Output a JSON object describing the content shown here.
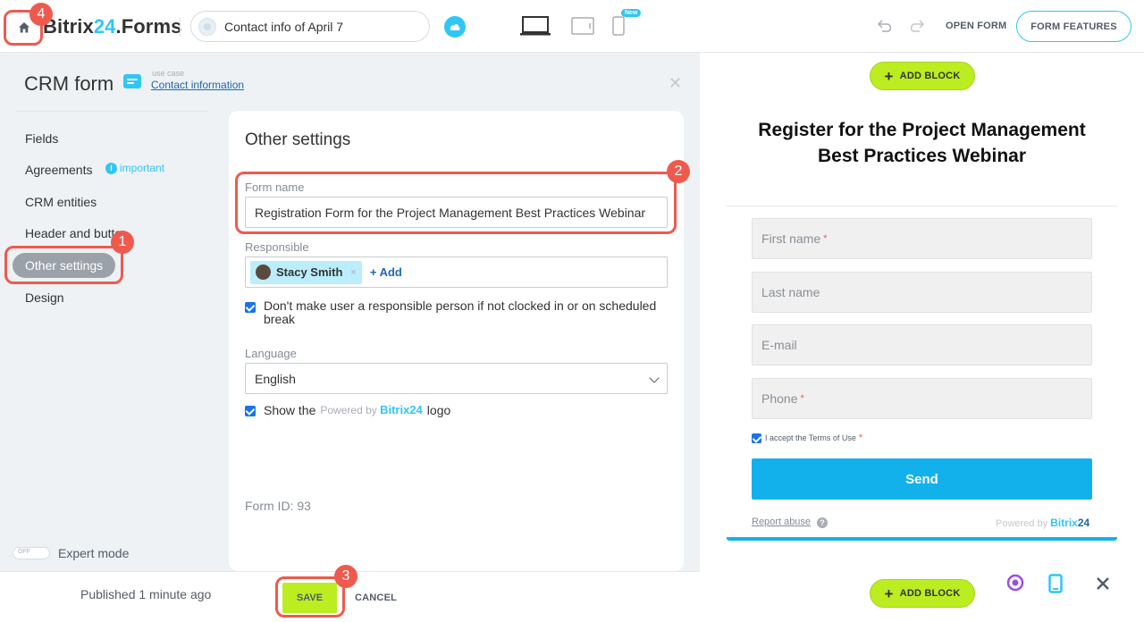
{
  "header": {
    "logo_part1": "Bitrix",
    "logo_part2": "24",
    "logo_part3": ".Forms",
    "form_title": "Contact info of April 7",
    "new_badge": "New",
    "open_form": "OPEN FORM",
    "form_features": "FORM FEATURES"
  },
  "sidebar": {
    "title": "CRM form",
    "use_case_label": "use case",
    "use_case_link": "Contact information",
    "important_label": "important",
    "items": [
      {
        "label": "Fields"
      },
      {
        "label": "Agreements"
      },
      {
        "label": "CRM entities"
      },
      {
        "label": "Header and butto"
      },
      {
        "label": "Other settings"
      },
      {
        "label": "Design"
      }
    ],
    "expert_toggle": "OFF",
    "expert_label": "Expert mode"
  },
  "settings": {
    "title": "Other settings",
    "form_name_label": "Form name",
    "form_name_value": "Registration Form for the Project Management Best Practices Webinar",
    "responsible_label": "Responsible",
    "responsible_name": "Stacy Smith",
    "remove_x": "×",
    "add_link": "+ Add",
    "clocked_checkbox": "Don't make user a responsible person if not clocked in or on scheduled break",
    "language_label": "Language",
    "language_value": "English",
    "show_the": "Show the",
    "powered_by": "Powered by",
    "bitrix_brand": "Bitrix24",
    "logo_word": "logo",
    "form_id": "Form ID: 93"
  },
  "footer": {
    "published": "Published 1 minute ago",
    "save": "SAVE",
    "cancel": "CANCEL"
  },
  "preview": {
    "add_block": "ADD BLOCK",
    "title": "Register for the Project Management Best Practices Webinar",
    "fields": [
      {
        "label": "First name",
        "required": "*"
      },
      {
        "label": "Last name",
        "required": ""
      },
      {
        "label": "E-mail",
        "required": ""
      },
      {
        "label": "Phone",
        "required": "*"
      }
    ],
    "terms": "I accept the Terms of Use",
    "terms_required": "*",
    "send": "Send",
    "report_abuse": "Report abuse",
    "qmark": "?",
    "powered_by": "Powered by",
    "bitrix_brand": "Bitrix",
    "bitrix_num": "24"
  },
  "annotations": [
    "1",
    "2",
    "3",
    "4"
  ],
  "colors": {
    "accent": "#2fc6f6",
    "save_green": "#bbed21",
    "send_blue": "#13b1ec",
    "highlight_red": "#ef5a4e"
  }
}
